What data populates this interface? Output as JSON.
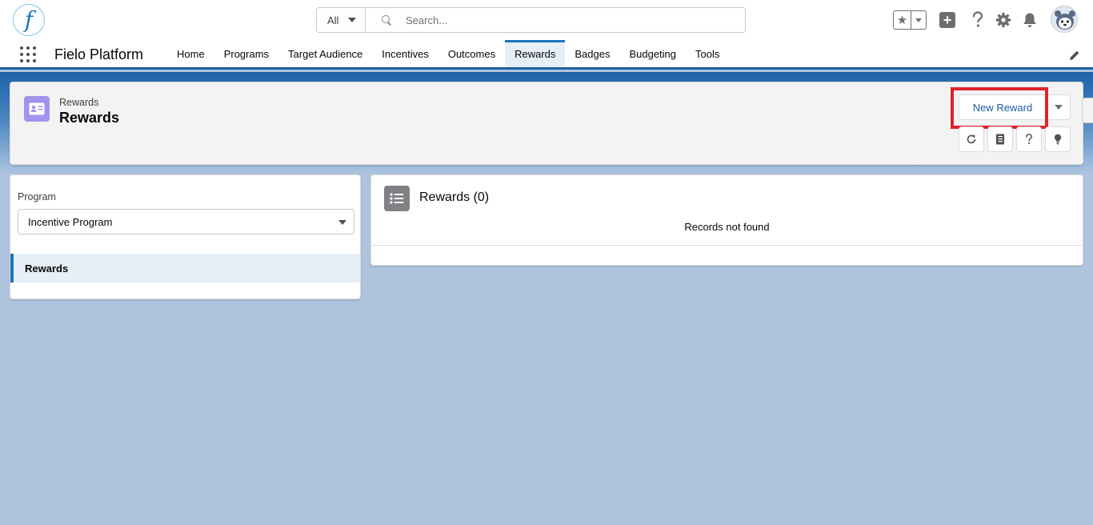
{
  "header": {
    "logo_letter": "f",
    "search_scope": "All",
    "search_placeholder": "Search...",
    "icons": [
      "favorites-star-icon",
      "add-icon",
      "help-icon",
      "setup-gear-icon",
      "notifications-bell-icon",
      "user-avatar"
    ]
  },
  "nav": {
    "app_name": "Fielo Platform",
    "items": [
      "Home",
      "Programs",
      "Target Audience",
      "Incentives",
      "Outcomes",
      "Rewards",
      "Badges",
      "Budgeting",
      "Tools"
    ],
    "active": "Rewards"
  },
  "page_header": {
    "object_label": "Rewards",
    "title": "Rewards",
    "new_button": "New Reward",
    "utility_icons": [
      "refresh-icon",
      "notebook-icon",
      "help-icon",
      "lightbulb-icon"
    ]
  },
  "left_panel": {
    "program_label": "Program",
    "program_value": "Incentive Program",
    "nav_item": "Rewards"
  },
  "right_panel": {
    "title": "Rewards (0)",
    "empty_message": "Records not found"
  },
  "colors": {
    "brand_blue": "#1b75bb",
    "highlight_red": "#e3212b",
    "object_icon_purple": "#a094ed",
    "page_background": "#b0c4df"
  }
}
